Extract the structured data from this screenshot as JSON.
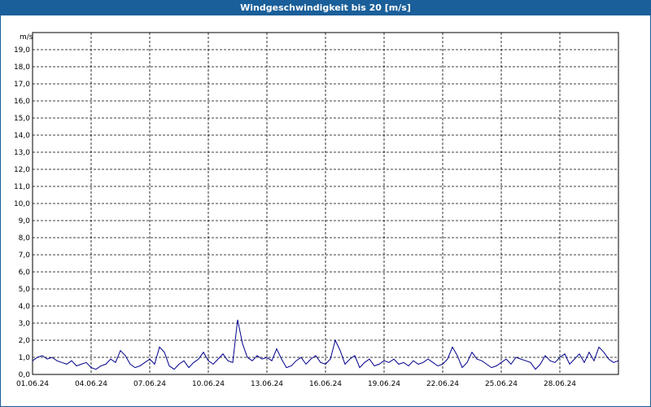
{
  "window": {
    "title": "Windgeschwindigkeit bis 20 [m/s]"
  },
  "chart_data": {
    "type": "line",
    "title": "Windgeschwindigkeit bis 20 [m/s]",
    "ylabel": "m/s",
    "xlabel": "",
    "ylim": [
      0,
      20
    ],
    "xlim": [
      "01.06.24",
      "01.07.24"
    ],
    "grid": true,
    "y_ticks": [
      "0,0",
      "1,0",
      "2,0",
      "3,0",
      "4,0",
      "5,0",
      "6,0",
      "7,0",
      "8,0",
      "9,0",
      "10,0",
      "11,0",
      "12,0",
      "13,0",
      "14,0",
      "15,0",
      "16,0",
      "17,0",
      "18,0",
      "19,0"
    ],
    "x_ticks": [
      "01.06.24",
      "04.06.24",
      "07.06.24",
      "10.06.24",
      "13.06.24",
      "16.06.24",
      "19.06.24",
      "22.06.24",
      "25.06.24",
      "28.06.24"
    ],
    "series": [
      {
        "color": "#00008b",
        "x_days": [
          0,
          0.25,
          0.5,
          0.75,
          1,
          1.25,
          1.5,
          1.75,
          2,
          2.25,
          2.5,
          2.75,
          3,
          3.25,
          3.5,
          3.75,
          4,
          4.25,
          4.5,
          4.75,
          5,
          5.25,
          5.5,
          5.75,
          6,
          6.25,
          6.5,
          6.75,
          7,
          7.25,
          7.5,
          7.75,
          8,
          8.25,
          8.5,
          8.75,
          9,
          9.25,
          9.5,
          9.75,
          10,
          10.25,
          10.5,
          10.75,
          11,
          11.25,
          11.5,
          11.75,
          12,
          12.25,
          12.5,
          12.75,
          13,
          13.25,
          13.5,
          13.75,
          14,
          14.25,
          14.5,
          14.75,
          15,
          15.25,
          15.5,
          15.75,
          16,
          16.25,
          16.5,
          16.75,
          17,
          17.25,
          17.5,
          17.75,
          18,
          18.25,
          18.5,
          18.75,
          19,
          19.25,
          19.5,
          19.75,
          20,
          20.25,
          20.5,
          20.75,
          21,
          21.25,
          21.5,
          21.75,
          22,
          22.25,
          22.5,
          22.75,
          23,
          23.25,
          23.5,
          23.75,
          24,
          24.25,
          24.5,
          24.75,
          25,
          25.25,
          25.5,
          25.75,
          26,
          26.25,
          26.5,
          26.75,
          27,
          27.25,
          27.5,
          27.75,
          28,
          28.25,
          28.5,
          28.75,
          29,
          29.25,
          29.5,
          29.75,
          30
        ],
        "values": [
          0.8,
          1.0,
          1.1,
          0.9,
          1.0,
          0.8,
          0.7,
          0.6,
          0.8,
          0.5,
          0.6,
          0.7,
          0.4,
          0.3,
          0.5,
          0.6,
          0.9,
          0.7,
          1.4,
          1.1,
          0.6,
          0.4,
          0.5,
          0.7,
          0.9,
          0.6,
          1.6,
          1.3,
          0.5,
          0.3,
          0.6,
          0.8,
          0.4,
          0.7,
          0.9,
          1.3,
          0.8,
          0.6,
          0.9,
          1.2,
          0.8,
          0.7,
          3.2,
          1.8,
          1.0,
          0.8,
          1.1,
          0.9,
          1.0,
          0.8,
          1.5,
          0.9,
          0.4,
          0.5,
          0.8,
          1.0,
          0.6,
          0.9,
          1.1,
          0.7,
          0.6,
          0.9,
          2.0,
          1.4,
          0.6,
          0.9,
          1.1,
          0.4,
          0.7,
          0.9,
          0.5,
          0.6,
          0.8,
          0.7,
          0.9,
          0.6,
          0.7,
          0.5,
          0.8,
          0.6,
          0.7,
          0.9,
          0.7,
          0.5,
          0.6,
          0.9,
          1.6,
          1.1,
          0.4,
          0.7,
          1.3,
          0.9,
          0.8,
          0.6,
          0.4,
          0.5,
          0.7,
          0.9,
          0.6,
          1.0,
          0.9,
          0.8,
          0.7,
          0.3,
          0.6,
          1.1,
          0.8,
          0.7,
          1.0,
          1.2,
          0.6,
          0.9,
          1.2,
          0.7,
          1.3,
          0.8,
          1.6,
          1.3,
          0.9,
          0.7,
          0.8,
          1.0,
          1.2,
          1.0,
          0.8
        ]
      }
    ]
  }
}
